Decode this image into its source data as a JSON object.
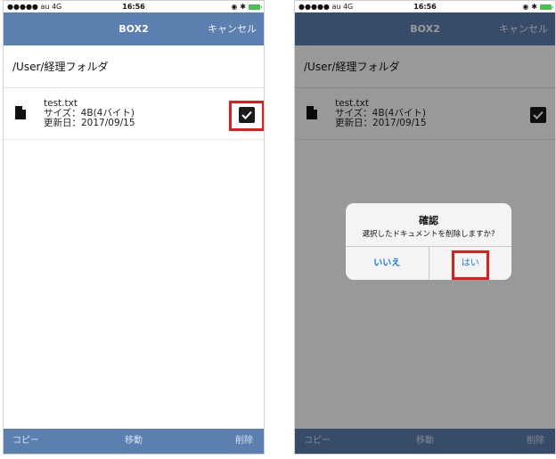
{
  "status": {
    "carrier": "●●●●● au  4G",
    "time": "16:56"
  },
  "nav": {
    "title": "BOX2",
    "cancel": "キャンセル"
  },
  "path": "/User/経理フォルダ",
  "file": {
    "name": "test.txt",
    "size": "サイズ：4B(4バイト)",
    "date": "更新日：2017/09/15",
    "checked": true
  },
  "toolbar": {
    "copy": "コピー",
    "move": "移動",
    "delete": "削除"
  },
  "dialog": {
    "title": "確認",
    "message": "選択したドキュメントを削除しますか?",
    "no": "いいえ",
    "yes": "はい"
  },
  "colors": {
    "accent": "#5b7fae",
    "highlight": "#e21b1b",
    "ios_blue": "#1877f2"
  }
}
